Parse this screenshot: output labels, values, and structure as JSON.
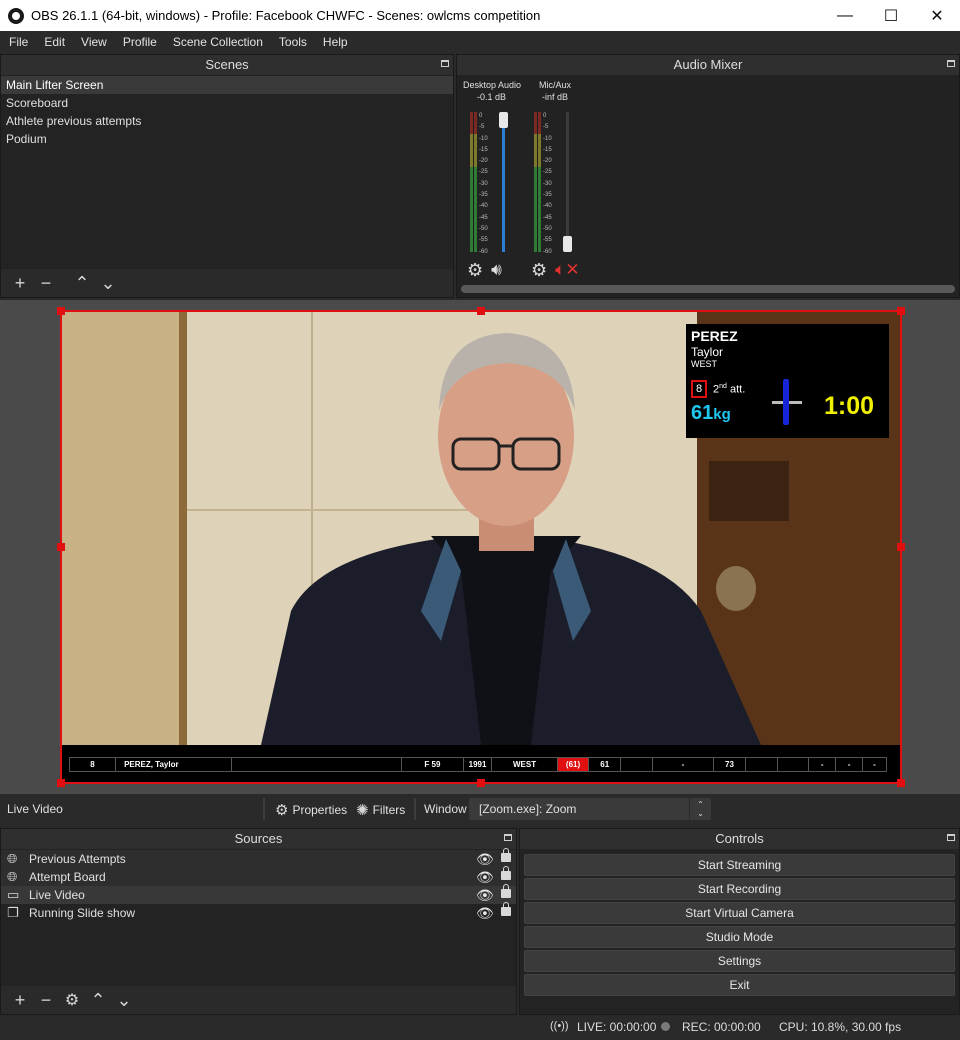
{
  "window": {
    "title": "OBS 26.1.1 (64-bit, windows) - Profile: Facebook CHWFC - Scenes: owlcms competition",
    "minimize_glyph": "—",
    "maximize_glyph": "☐",
    "close_glyph": "✕"
  },
  "menu": [
    "File",
    "Edit",
    "View",
    "Profile",
    "Scene Collection",
    "Tools",
    "Help"
  ],
  "scenes": {
    "title": "Scenes",
    "items": [
      "Main Lifter Screen",
      "Scoreboard",
      "Athlete previous attempts",
      "Podium"
    ],
    "selected_index": 0
  },
  "mixer": {
    "title": "Audio Mixer",
    "channels": [
      {
        "name": "Desktop Audio",
        "db": "-0.1 dB",
        "muted": false,
        "volume": 1.0
      },
      {
        "name": "Mic/Aux",
        "db": "-inf dB",
        "muted": true,
        "volume": 0.0
      }
    ],
    "ticks": [
      "0",
      "-5",
      "-10",
      "-15",
      "-20",
      "-25",
      "-30",
      "-35",
      "-40",
      "-45",
      "-50",
      "-55",
      "-60"
    ]
  },
  "overlay": {
    "last_name": "PEREZ",
    "first_name": "Taylor",
    "team": "WEST",
    "start_number": "8",
    "attempt_num": "2",
    "attempt_sup": "nd",
    "attempt_suffix": " att.",
    "weight": "61",
    "weight_unit": "kg",
    "clock": "1:00"
  },
  "scoreboard": {
    "cells": [
      "8",
      "PEREZ, Taylor",
      "",
      "F 59",
      "1991",
      "WEST",
      "(61)",
      "61",
      "",
      "-",
      "73",
      "",
      "",
      "-",
      "-",
      "-"
    ]
  },
  "context": {
    "source": "Live Video",
    "properties": "Properties",
    "filters": "Filters",
    "window_label": "Window",
    "window_value": "[Zoom.exe]: Zoom"
  },
  "sources": {
    "title": "Sources",
    "items": [
      {
        "name": "Previous Attempts",
        "icon": "globe-icon"
      },
      {
        "name": "Attempt Board",
        "icon": "globe-icon"
      },
      {
        "name": "Live Video",
        "icon": "window-icon"
      },
      {
        "name": "Running Slide show",
        "icon": "slideshow-icon"
      }
    ]
  },
  "controls": {
    "title": "Controls",
    "buttons": [
      "Start Streaming",
      "Start Recording",
      "Start Virtual Camera",
      "Studio Mode",
      "Settings",
      "Exit"
    ]
  },
  "status": {
    "live": "LIVE: 00:00:00",
    "rec": "REC: 00:00:00",
    "cpu": "CPU: 10.8%, 30.00 fps"
  },
  "colors": {
    "selection_red": "#e01010",
    "clock_yellow": "#f0f000",
    "weight_cyan": "#1ec8f0"
  }
}
